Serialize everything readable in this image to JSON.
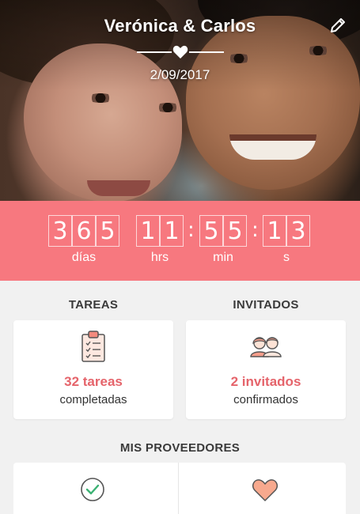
{
  "header": {
    "couple_names": "Verónica & Carlos",
    "wedding_date": "2/09/2017",
    "edit_icon": "pencil-icon",
    "divider_icon": "heart-icon"
  },
  "countdown": {
    "days_digits": [
      "3",
      "6",
      "5"
    ],
    "hours_digits": [
      "1",
      "1"
    ],
    "minutes_digits": [
      "5",
      "5"
    ],
    "seconds_digits": [
      "1",
      "3"
    ],
    "labels": {
      "days": "días",
      "hours": "hrs",
      "minutes": "min",
      "seconds": "s"
    },
    "color": "#f7787f"
  },
  "sections": {
    "tasks": {
      "title": "TAREAS",
      "count": "32 tareas",
      "subtitle": "completadas",
      "icon": "clipboard-checklist-icon"
    },
    "guests": {
      "title": "INVITADOS",
      "count": "2 invitados",
      "subtitle": "confirmados",
      "icon": "couple-icon"
    },
    "providers": {
      "title": "MIS PROVEEDORES",
      "items": [
        {
          "icon": "check-circle-icon"
        },
        {
          "icon": "heart-icon"
        }
      ]
    }
  },
  "colors": {
    "accent": "#f7787f",
    "count_text": "#e5646b",
    "background": "#f1f1f1"
  }
}
